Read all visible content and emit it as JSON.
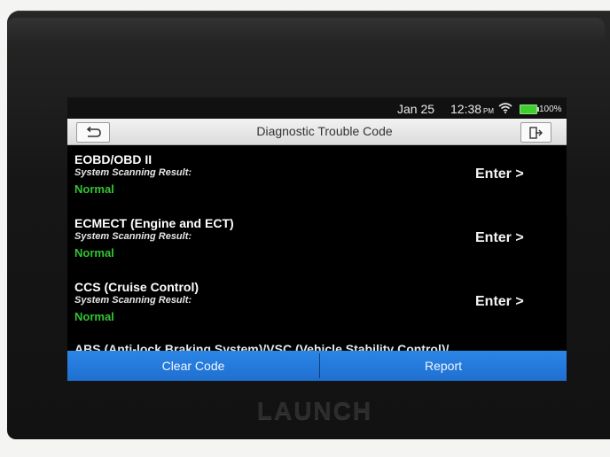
{
  "status_bar": {
    "date": "Jan 25",
    "time": "12:38",
    "ampm": "PM",
    "battery": "100%",
    "icons": [
      "wifi-icon",
      "battery-icon"
    ]
  },
  "title_bar": {
    "title": "Diagnostic Trouble Code",
    "back_icon": "back-arrow-icon",
    "exit_icon": "exit-icon"
  },
  "systems": [
    {
      "name": "EOBD/OBD II",
      "label": "System Scanning Result:",
      "status": "Normal",
      "action": "Enter >"
    },
    {
      "name": "ECMECT (Engine and ECT)",
      "label": "System Scanning Result:",
      "status": "Normal",
      "action": "Enter >"
    },
    {
      "name": "CCS (Cruise Control)",
      "label": "System Scanning Result:",
      "status": "Normal",
      "action": "Enter >"
    }
  ],
  "partial_item": "ABS (Anti-lock Braking System)/VSC (Vehicle Stability Control)/...",
  "bottom_bar": {
    "clear_label": "Clear Code",
    "report_label": "Report"
  },
  "brand": "LAUNCH",
  "colors": {
    "accent": "#2b86e6",
    "status_ok": "#34c233",
    "screen_bg": "#000000"
  }
}
